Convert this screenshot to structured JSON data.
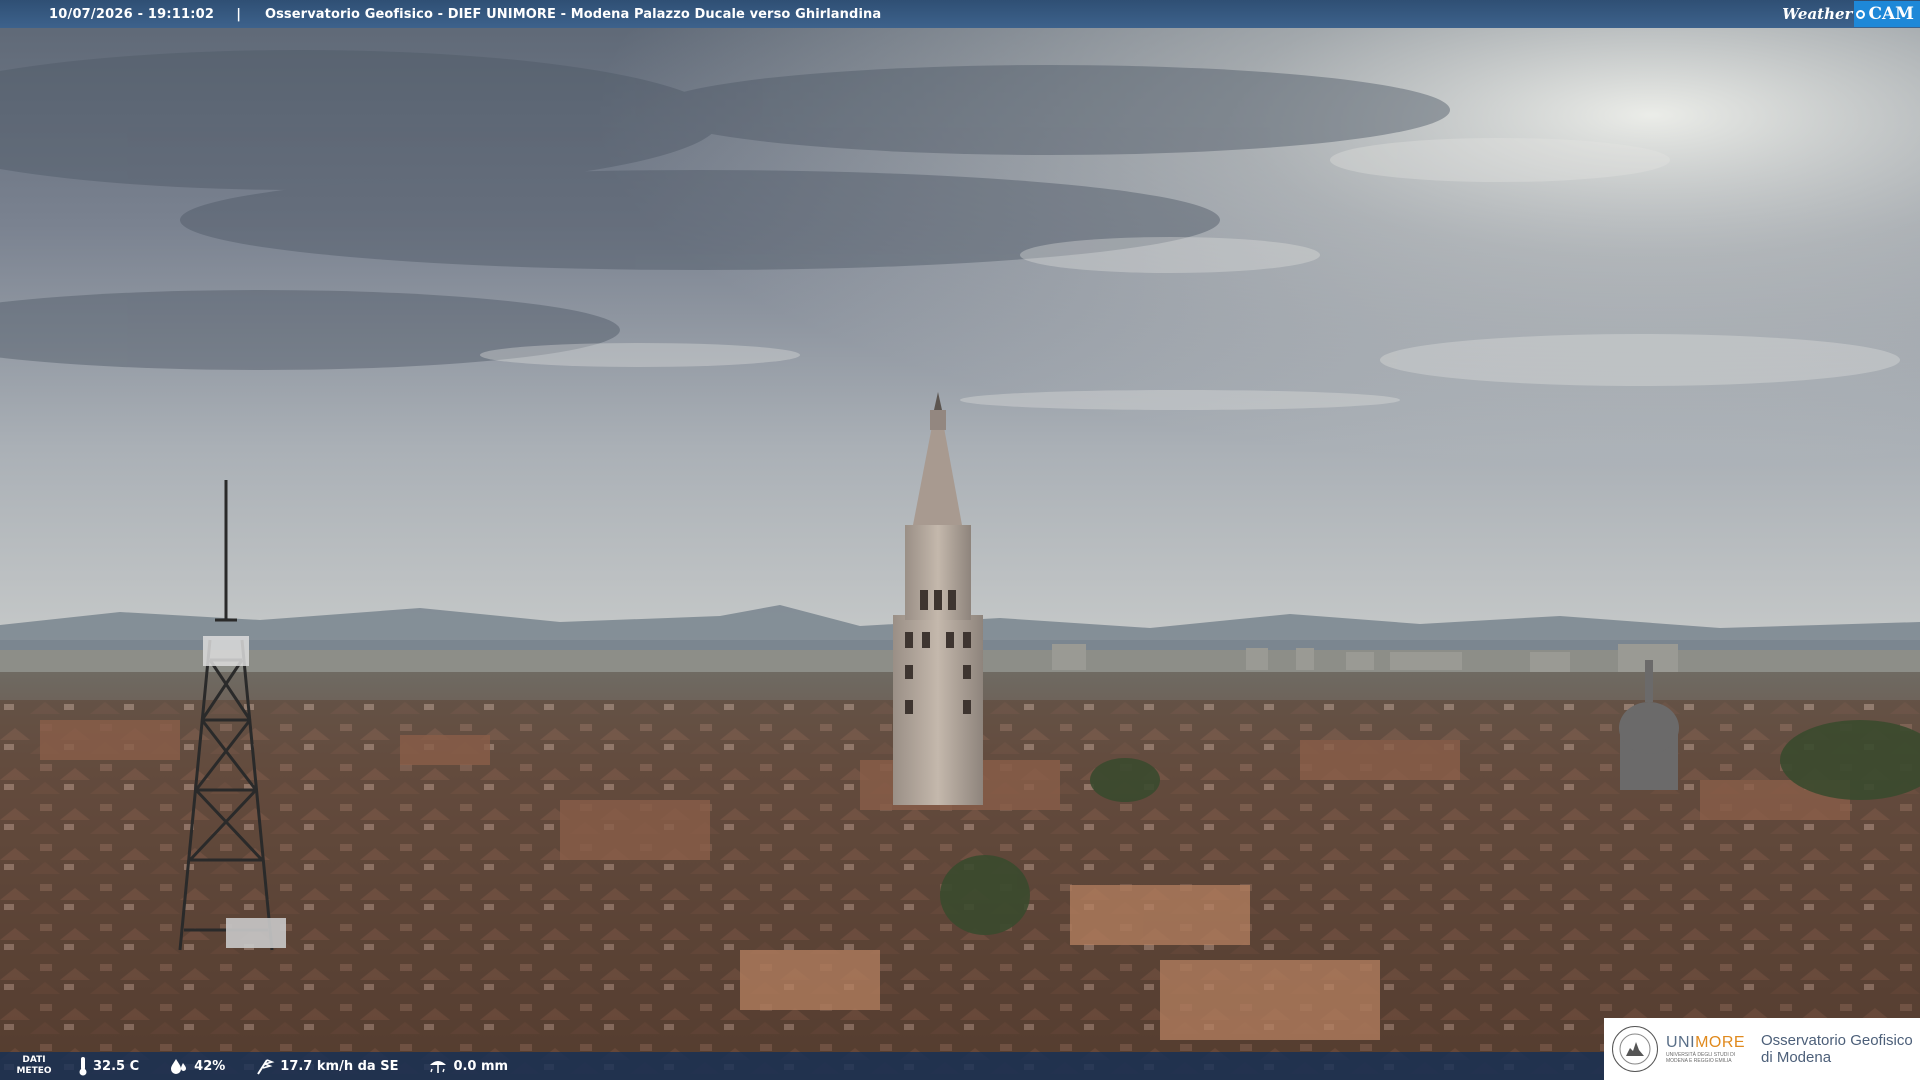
{
  "header": {
    "timestamp": "10/07/2026 - 19:11:02",
    "separator": "|",
    "title": "Osservatorio Geofisico - DIEF UNIMORE - Modena Palazzo Ducale verso Ghirlandina",
    "logo_prefix": "Weather",
    "logo_suffix": "CAM"
  },
  "footer": {
    "dati_label_line1": "DATI",
    "dati_label_line2": "METEO",
    "temperature": "32.5 C",
    "humidity": "42%",
    "wind": "17.7 km/h da SE",
    "rain": "0.0 mm",
    "icons": [
      "thermometer-icon",
      "humidity-drop-icon",
      "wind-icon",
      "rain-gauge-icon"
    ]
  },
  "logo": {
    "uni_part1": "UNI",
    "uni_part2": "MORE",
    "uni_subtitle": "UNIVERSITÀ DEGLI STUDI DI MODENA E REGGIO EMILIA",
    "observatory_line1": "Osservatorio Geofisico",
    "observatory_line2": "di Modena"
  },
  "colors": {
    "header_bg": "#2f4f74",
    "footer_bg": "#163056",
    "unimore_blue": "#5a6f88",
    "unimore_orange": "#e08a1e",
    "weathercam_blue": "#1e88d8"
  }
}
